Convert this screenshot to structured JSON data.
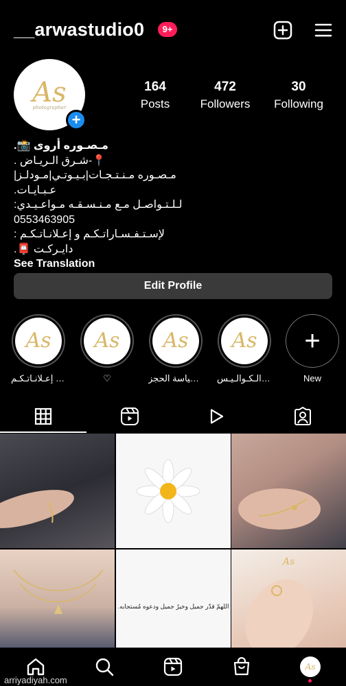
{
  "header": {
    "username": "__arwastudio0",
    "notification_badge": "9+"
  },
  "profile": {
    "avatar_logo": "As",
    "avatar_logo_sub": "photographer",
    "stats": [
      {
        "value": "164",
        "label": "Posts"
      },
      {
        "value": "472",
        "label": "Followers"
      },
      {
        "value": "30",
        "label": "Following"
      }
    ],
    "bio_lines": [
      "مـصـوره أروى 📸.",
      "📍-شـرق الـريـاض .",
      "مـصـوره مـنـتـجـات|بـيـوتـي|مـودلـز|عـبـايـات.",
      "لـلـتـواصـل مـع مـنـسـقـه مـواعـيـدي:",
      "0553463905",
      "لإسـتـفـسـاراتـكـم و إعـلانـاتـكـم :",
      "دايـركـت 📮."
    ],
    "see_translation": "See Translation",
    "edit_profile": "Edit Profile"
  },
  "highlights": [
    {
      "label": "إعـلانـاتـكـم 📲"
    },
    {
      "label": "♡"
    },
    {
      "label": "سياسة الحجز..."
    },
    {
      "label": "الـكـوالـيـس ✨"
    },
    {
      "label": "New"
    }
  ],
  "grid": {
    "quote_text": "اللهمّ قدّر جميل وخيرٌ جميل ودعوه مُستجابه.",
    "cell_logo": "As"
  },
  "watermark": "arriyadiyah.com"
}
